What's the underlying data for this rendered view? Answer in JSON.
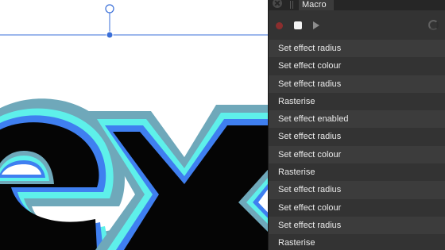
{
  "panel": {
    "tab_label": "Macro",
    "colors": {
      "record": "#8b2e2e",
      "panel_bg": "#333333",
      "row_alt": "#3c3c3c"
    },
    "icons": [
      "close-icon",
      "record-icon",
      "stop-icon",
      "play-icon",
      "spinner-icon"
    ]
  },
  "macro_steps": [
    "Set effect radius",
    "Set effect colour",
    "Set effect radius",
    "Rasterise",
    "Set effect enabled",
    "Set effect radius",
    "Set effect colour",
    "Rasterise",
    "Set effect radius",
    "Set effect colour",
    "Set effect radius",
    "Rasterise"
  ],
  "canvas": {
    "artwork_text": "ex",
    "colors": {
      "outer_stroke": "#6fa8ba",
      "cyan_stroke": "#5ef0ea",
      "blue_stroke": "#3f7ff0",
      "fill": "#050505",
      "guide": "#3a6fd8"
    }
  }
}
